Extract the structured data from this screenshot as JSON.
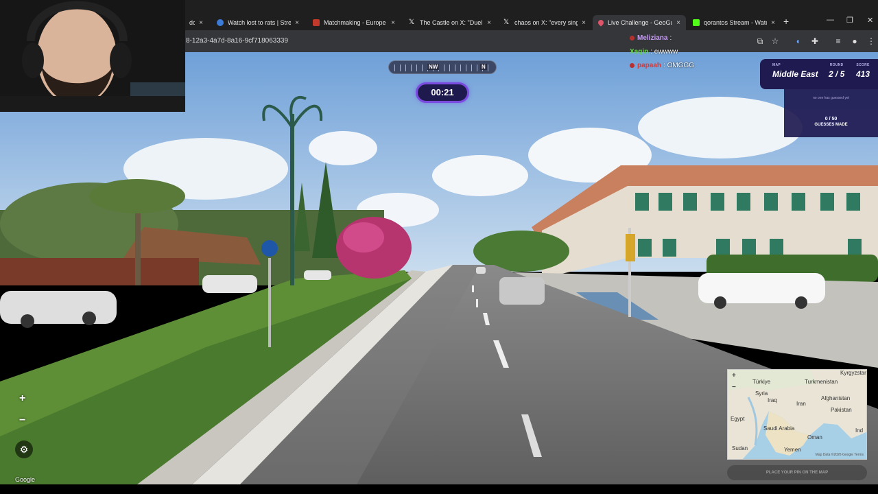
{
  "browser": {
    "tabs": [
      {
        "label": "dc",
        "color": "#7a7a7a",
        "active": false
      },
      {
        "label": "Watch lost to rats | Stream",
        "color": "#3d7bd9",
        "active": false
      },
      {
        "label": "Matchmaking - Europe Se",
        "color": "#c0392b",
        "active": false
      },
      {
        "label": "The Castle on X: \"Duel Liv",
        "color": "#ffffff",
        "active": false
      },
      {
        "label": "chaos on X: \"every single",
        "color": "#ffffff",
        "active": false
      },
      {
        "label": "Live Challenge - GeoGues",
        "color": "#e0556a",
        "active": true
      },
      {
        "label": "qorantos Stream - Watch",
        "color": "#53fc18",
        "active": false
      }
    ],
    "tab_close": "×",
    "new_tab": "+",
    "minimize": "—",
    "restore": "❐",
    "close": "✕",
    "url": "8-12a3-4a7d-8a16-9cf718063339"
  },
  "hud": {
    "compass_left": "NW",
    "compass_right": "N",
    "timer": "00:21"
  },
  "chat": [
    {
      "user": "Meliziana",
      "msg": ":",
      "color": "#c59cf0",
      "dot": true
    },
    {
      "user": "Xaqin",
      "msg": ": ewwww",
      "color": "#6ad34a",
      "dot": false
    },
    {
      "user": "papaah",
      "msg": ": OMGGG",
      "color": "#d13b3b",
      "dot": true
    }
  ],
  "stats": {
    "map_label": "MAP",
    "map_value": "Middle East",
    "round_label": "ROUND",
    "round_value": "2 / 5",
    "score_label": "SCORE",
    "score_value": "413",
    "no_guess": "no one has guessed yet",
    "guess_count": "0 / 50",
    "guesses_made": "GUESSES MADE"
  },
  "controls": {
    "zoom_in": "+",
    "zoom_out": "−",
    "settings": "⚙",
    "google": "Google"
  },
  "minimap": {
    "zoom_in": "+",
    "zoom_out": "−",
    "labels": [
      "Türkiye",
      "Turkmenistan",
      "Kyrgyzstan",
      "Syria",
      "Iraq",
      "Iran",
      "Afghanistan",
      "Pakistan",
      "Egypt",
      "Saudi Arabia",
      "Oman",
      "Sudan",
      "Yemen",
      "Ind"
    ],
    "footer": "Map Data ©2026 Google   Terms",
    "place_pin": "PLACE YOUR PIN ON THE MAP"
  },
  "colors": {
    "hud_purple": "#1f1a50",
    "timer_ring": "#7b4be0"
  }
}
